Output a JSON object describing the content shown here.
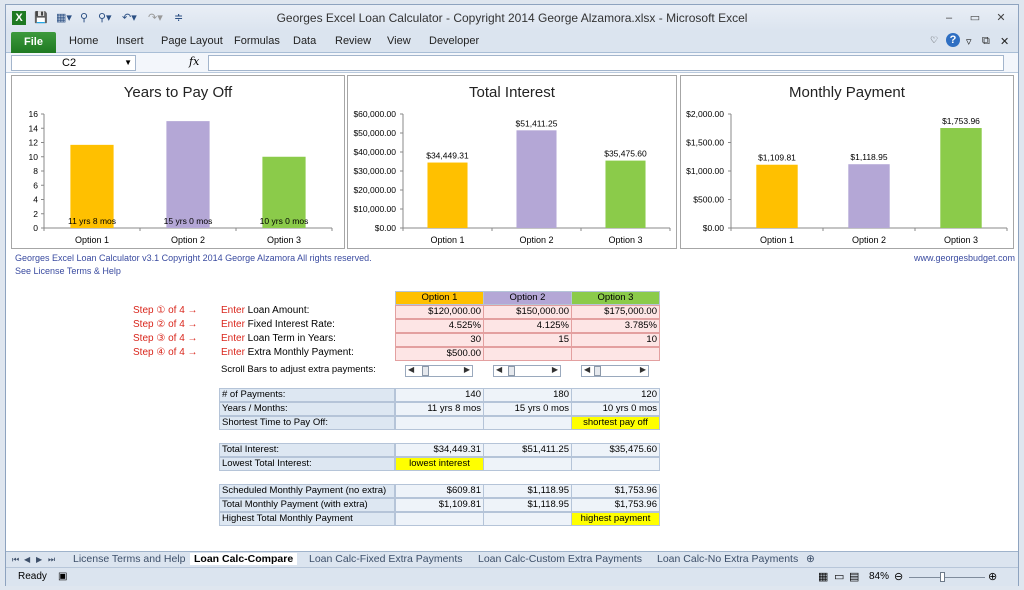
{
  "window": {
    "title": "Georges Excel Loan Calculator - Copyright 2014 George Alzamora.xlsx  -  Microsoft Excel",
    "controls": [
      "–",
      "▭",
      "✕"
    ]
  },
  "ribbon": {
    "file_label": "File",
    "tabs": [
      "Home",
      "Insert",
      "Page Layout",
      "Formulas",
      "Data",
      "Review",
      "View",
      "Developer"
    ]
  },
  "formula_bar": {
    "name_box": "C2",
    "fx": "fx",
    "value": ""
  },
  "charts": [
    {
      "title": "Years to Pay Off",
      "type": "bar",
      "categories": [
        "Option 1",
        "Option 2",
        "Option 3"
      ],
      "values": [
        11.67,
        15,
        10
      ],
      "data_labels": [
        "11 yrs 8 mos",
        "15 yrs 0 mos",
        "10 yrs 0 mos"
      ],
      "y_ticks": [
        "16",
        "14",
        "12",
        "10",
        "8",
        "6",
        "4",
        "2",
        "0"
      ],
      "ylim": [
        0,
        16
      ],
      "colors": [
        "#ffc000",
        "#b4a7d6",
        "#8bcb4a"
      ]
    },
    {
      "title": "Total Interest",
      "type": "bar",
      "categories": [
        "Option 1",
        "Option 2",
        "Option 3"
      ],
      "values": [
        34449.31,
        51411.25,
        35475.6
      ],
      "data_labels": [
        "$34,449.31",
        "$51,411.25",
        "$35,475.60"
      ],
      "y_ticks": [
        "$60,000.00",
        "$50,000.00",
        "$40,000.00",
        "$30,000.00",
        "$20,000.00",
        "$10,000.00",
        "$0.00"
      ],
      "ylim": [
        0,
        60000
      ],
      "colors": [
        "#ffc000",
        "#b4a7d6",
        "#8bcb4a"
      ]
    },
    {
      "title": "Monthly Payment",
      "type": "bar",
      "categories": [
        "Option 1",
        "Option 2",
        "Option 3"
      ],
      "values": [
        1109.81,
        1118.95,
        1753.96
      ],
      "data_labels": [
        "$1,109.81",
        "$1,118.95",
        "$1,753.96"
      ],
      "y_ticks": [
        "$2,000.00",
        "$1,500.00",
        "$1,000.00",
        "$500.00",
        "$0.00"
      ],
      "ylim": [
        0,
        2000
      ],
      "colors": [
        "#ffc000",
        "#b4a7d6",
        "#8bcb4a"
      ]
    }
  ],
  "chart_data": [
    {
      "type": "bar",
      "title": "Years to Pay Off",
      "categories": [
        "Option 1",
        "Option 2",
        "Option 3"
      ],
      "values": [
        11.67,
        15,
        10
      ],
      "ylim": [
        0,
        16
      ]
    },
    {
      "type": "bar",
      "title": "Total Interest",
      "categories": [
        "Option 1",
        "Option 2",
        "Option 3"
      ],
      "values": [
        34449.31,
        51411.25,
        35475.6
      ],
      "ylim": [
        0,
        60000
      ]
    },
    {
      "type": "bar",
      "title": "Monthly Payment",
      "categories": [
        "Option 1",
        "Option 2",
        "Option 3"
      ],
      "values": [
        1109.81,
        1118.95,
        1753.96
      ],
      "ylim": [
        0,
        2000
      ]
    }
  ],
  "notes": {
    "credit": "Georges Excel Loan Calculator v3.1   Copyright 2014  George Alzamora  All rights reserved.",
    "license": "See License Terms & Help",
    "website": "www.georgesbudget.com"
  },
  "steps": [
    {
      "step": "Step ① of 4 →",
      "enter": "Enter",
      "label": " Loan Amount:"
    },
    {
      "step": "Step ② of 4 →",
      "enter": "Enter",
      "label": " Fixed Interest Rate:"
    },
    {
      "step": "Step ③ of 4 →",
      "enter": "Enter",
      "label": " Loan Term in Years:"
    },
    {
      "step": "Step ④ of 4 →",
      "enter": "Enter",
      "label": " Extra Monthly Payment:"
    }
  ],
  "table": {
    "headers": [
      "Option 1",
      "Option 2",
      "Option 3"
    ],
    "inputs": [
      [
        "$120,000.00",
        "$150,000.00",
        "$175,000.00"
      ],
      [
        "4.525%",
        "4.125%",
        "3.785%"
      ],
      [
        "30",
        "15",
        "10"
      ],
      [
        "$500.00",
        "",
        ""
      ]
    ],
    "scroll_label": "Scroll Bars to adjust extra payments:",
    "scroll_levels": [
      0.1,
      0.05,
      0.0
    ],
    "block1": [
      {
        "label": "# of Payments:",
        "values": [
          "140",
          "180",
          "120"
        ]
      },
      {
        "label": "Years / Months:",
        "values": [
          "11 yrs 8 mos",
          "15 yrs 0 mos",
          "10 yrs 0 mos"
        ]
      },
      {
        "label": "Shortest Time to Pay Off:",
        "values": [
          "",
          "",
          "shortest pay off"
        ]
      }
    ],
    "block2": [
      {
        "label": "Total Interest:",
        "values": [
          "$34,449.31",
          "$51,411.25",
          "$35,475.60"
        ]
      },
      {
        "label": "Lowest Total Interest:",
        "values": [
          "lowest interest",
          "",
          ""
        ]
      }
    ],
    "block3": [
      {
        "label": "Scheduled Monthly Payment (no extra)",
        "values": [
          "$609.81",
          "$1,118.95",
          "$1,753.96"
        ]
      },
      {
        "label": "Total Monthly Payment (with extra)",
        "values": [
          "$1,109.81",
          "$1,118.95",
          "$1,753.96"
        ]
      },
      {
        "label": "Highest Total Monthly Payment",
        "values": [
          "",
          "",
          "highest payment"
        ]
      }
    ]
  },
  "sheet_tabs": [
    "License Terms and Help",
    "Loan Calc-Compare",
    "Loan Calc-Fixed Extra Payments",
    "Loan Calc-Custom Extra Payments",
    "Loan Calc-No Extra Payments"
  ],
  "status": {
    "ready": "Ready",
    "zoom": "84%"
  }
}
